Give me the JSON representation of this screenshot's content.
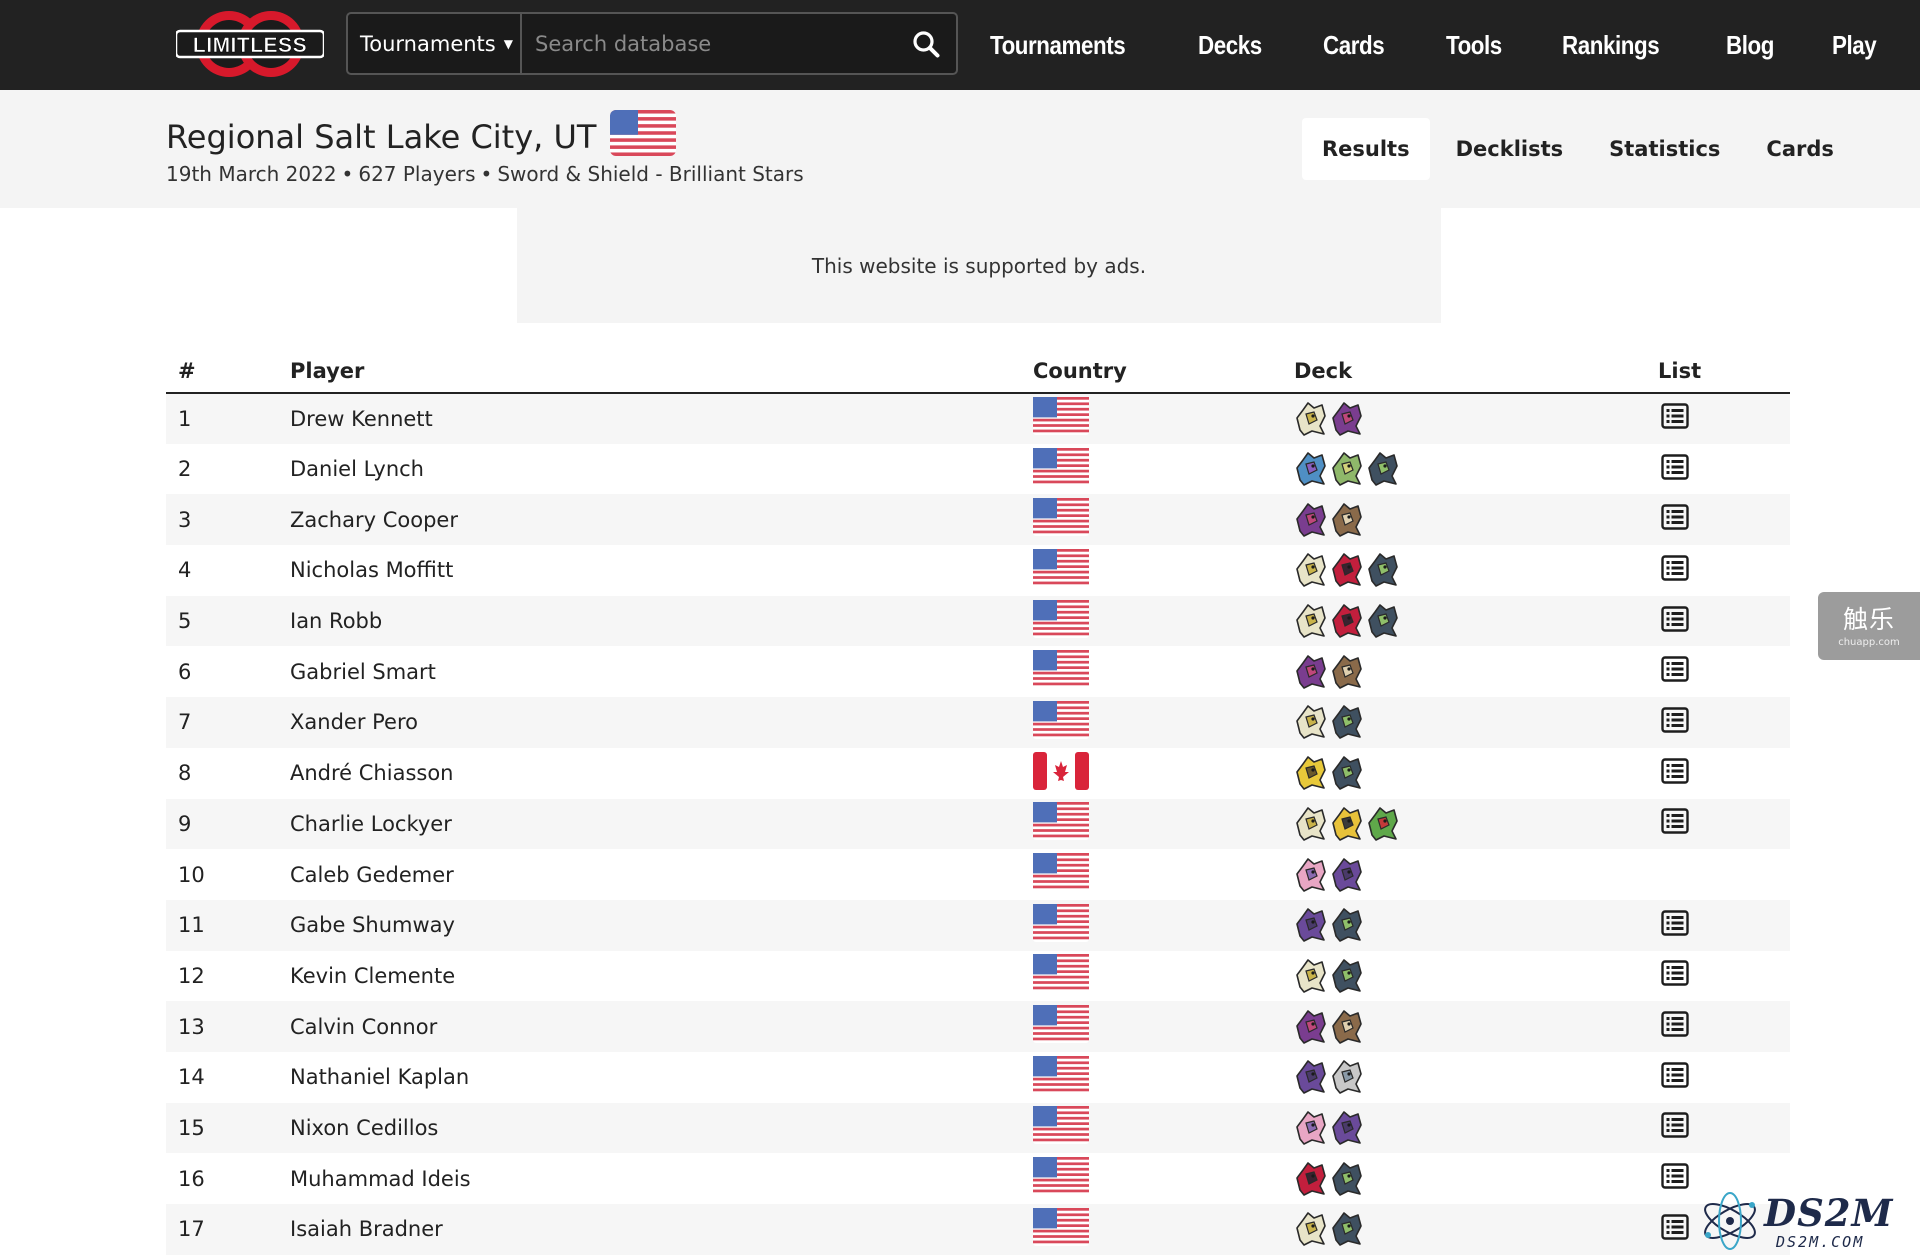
{
  "nav": {
    "logo_text": "LIMITLESS",
    "search_category": "Tournaments",
    "search_placeholder": "Search database",
    "links": [
      "Tournaments",
      "Decks",
      "Cards",
      "Tools",
      "Rankings",
      "Blog",
      "Play"
    ]
  },
  "tournament": {
    "title": "Regional Salt Lake City, UT",
    "date": "19th March 2022",
    "players": "627 Players",
    "format": "Sword & Shield - Brilliant Stars",
    "separator": "•"
  },
  "tabs": [
    "Results",
    "Decklists",
    "Statistics",
    "Cards"
  ],
  "active_tab": "Results",
  "ad_text": "This website is supported by ads.",
  "table": {
    "headers": [
      "#",
      "Player",
      "Country",
      "Deck",
      "List"
    ],
    "rows": [
      {
        "rank": "1",
        "player": "Drew Kennett",
        "country": "us",
        "deck": [
          "arceus",
          "gengar"
        ],
        "list": true
      },
      {
        "rank": "2",
        "player": "Daniel Lynch",
        "country": "us",
        "deck": [
          "suicune",
          "celebi",
          "inteleon"
        ],
        "list": true
      },
      {
        "rank": "3",
        "player": "Zachary Cooper",
        "country": "us",
        "deck": [
          "gengar",
          "raichu"
        ],
        "list": true
      },
      {
        "rank": "4",
        "player": "Nicholas Moffitt",
        "country": "us",
        "deck": [
          "arceus",
          "yveltal",
          "inteleon"
        ],
        "list": true
      },
      {
        "rank": "5",
        "player": "Ian Robb",
        "country": "us",
        "deck": [
          "arceus",
          "yveltal",
          "inteleon"
        ],
        "list": true
      },
      {
        "rank": "6",
        "player": "Gabriel Smart",
        "country": "us",
        "deck": [
          "gengar",
          "raichu"
        ],
        "list": true
      },
      {
        "rank": "7",
        "player": "Xander Pero",
        "country": "us",
        "deck": [
          "arceus",
          "inteleon"
        ],
        "list": true
      },
      {
        "rank": "8",
        "player": "André Chiasson",
        "country": "ca",
        "deck": [
          "jolteon",
          "inteleon"
        ],
        "list": true
      },
      {
        "rank": "9",
        "player": "Charlie Lockyer",
        "country": "us",
        "deck": [
          "arceus",
          "zeraora",
          "flygon"
        ],
        "list": true
      },
      {
        "rank": "10",
        "player": "Caleb Gedemer",
        "country": "us",
        "deck": [
          "mew",
          "genesect"
        ],
        "list": false
      },
      {
        "rank": "11",
        "player": "Gabe Shumway",
        "country": "us",
        "deck": [
          "genesect",
          "inteleon"
        ],
        "list": true
      },
      {
        "rank": "12",
        "player": "Kevin Clemente",
        "country": "us",
        "deck": [
          "arceus",
          "inteleon"
        ],
        "list": true
      },
      {
        "rank": "13",
        "player": "Calvin Connor",
        "country": "us",
        "deck": [
          "gengar",
          "raichu"
        ],
        "list": true
      },
      {
        "rank": "14",
        "player": "Nathaniel Kaplan",
        "country": "us",
        "deck": [
          "genesect",
          "regigigas"
        ],
        "list": true
      },
      {
        "rank": "15",
        "player": "Nixon Cedillos",
        "country": "us",
        "deck": [
          "mew",
          "genesect"
        ],
        "list": true
      },
      {
        "rank": "16",
        "player": "Muhammad Ideis",
        "country": "us",
        "deck": [
          "yveltal",
          "inteleon"
        ],
        "list": true
      },
      {
        "rank": "17",
        "player": "Isaiah Bradner",
        "country": "us",
        "deck": [
          "arceus",
          "inteleon"
        ],
        "list": true
      }
    ]
  },
  "watermarks": {
    "badge_big": "触乐",
    "badge_small": "chuapp.com",
    "ds_big": "DS2M",
    "ds_small": "DS2M.COM"
  },
  "colors": {
    "navbar": "#222222",
    "header_bg": "#f4f4f4",
    "row_stripe": "#f6f6f6",
    "logo_red": "#d7192b"
  },
  "deck_icon_colors": {
    "arceus": [
      "#e8e4c8",
      "#c9b34a"
    ],
    "gengar": [
      "#7a3d8f",
      "#c0477a"
    ],
    "suicune": [
      "#4f8fc4",
      "#8a5fbf"
    ],
    "celebi": [
      "#8fb86a",
      "#d2d27a"
    ],
    "inteleon": [
      "#3f5060",
      "#8fbf6a"
    ],
    "yveltal": [
      "#c21f3d",
      "#3a2230"
    ],
    "raichu": [
      "#8a6a4a",
      "#e0d0b0"
    ],
    "jolteon": [
      "#e8c93a",
      "#6a5a2a"
    ],
    "zeraora": [
      "#e8c23a",
      "#3a3a3a"
    ],
    "flygon": [
      "#5fa84a",
      "#c23a3a"
    ],
    "mew": [
      "#e8a6c4",
      "#8a6ab0"
    ],
    "genesect": [
      "#6a4a9a",
      "#4a3a6a"
    ],
    "regigigas": [
      "#c8c8c8",
      "#8a9aa8"
    ]
  }
}
